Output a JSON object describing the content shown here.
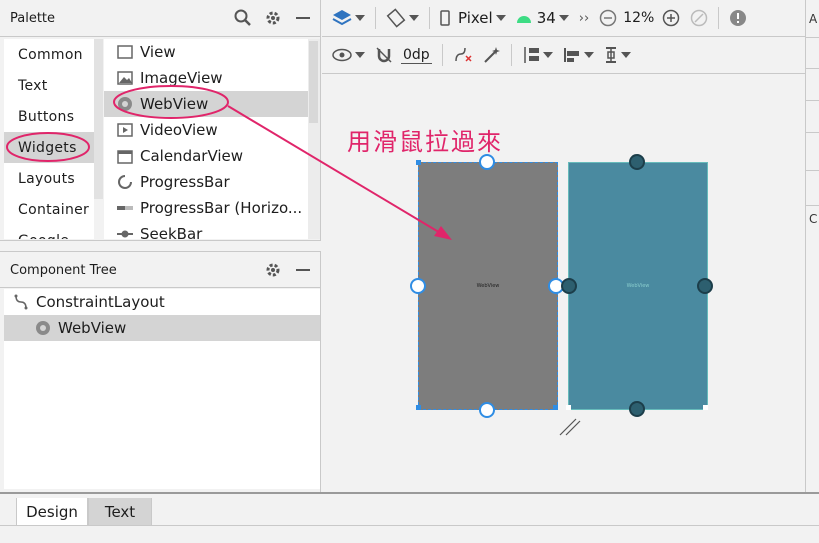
{
  "palette": {
    "title": "Palette",
    "categories": [
      {
        "label": "Common"
      },
      {
        "label": "Text"
      },
      {
        "label": "Buttons"
      },
      {
        "label": "Widgets"
      },
      {
        "label": "Layouts"
      },
      {
        "label": "Container"
      },
      {
        "label": "Google"
      }
    ],
    "widgets": [
      {
        "label": "View",
        "icon": "view-icon"
      },
      {
        "label": "ImageView",
        "icon": "imageview-icon"
      },
      {
        "label": "WebView",
        "icon": "webview-icon"
      },
      {
        "label": "VideoView",
        "icon": "videoview-icon"
      },
      {
        "label": "CalendarView",
        "icon": "calendarview-icon"
      },
      {
        "label": "ProgressBar",
        "icon": "progressbar-icon"
      },
      {
        "label": "ProgressBar (Horizo...",
        "icon": "progressbar-horizontal-icon"
      },
      {
        "label": "SeekBar",
        "icon": "seekbar-icon"
      }
    ]
  },
  "component_tree": {
    "title": "Component Tree",
    "items": [
      {
        "label": "ConstraintLayout",
        "icon": "constraintlayout-icon"
      },
      {
        "label": "WebView",
        "icon": "webview-icon"
      }
    ]
  },
  "toolbar": {
    "device": "Pixel",
    "api_level": "34",
    "zoom": "12%",
    "default_margin": "0dp"
  },
  "canvas": {
    "annotation": "用滑鼠拉過來",
    "design_label": "WebView",
    "blueprint_label": "WebView"
  },
  "right_panel": {
    "letter": "A",
    "letter2": "C"
  },
  "bottom_tabs": {
    "design": "Design",
    "text": "Text"
  },
  "colors": {
    "annotation": "#e0256a",
    "selection": "#2f8de4",
    "blueprint": "#4a8aa0",
    "design_surface": "#7d7d7d"
  }
}
